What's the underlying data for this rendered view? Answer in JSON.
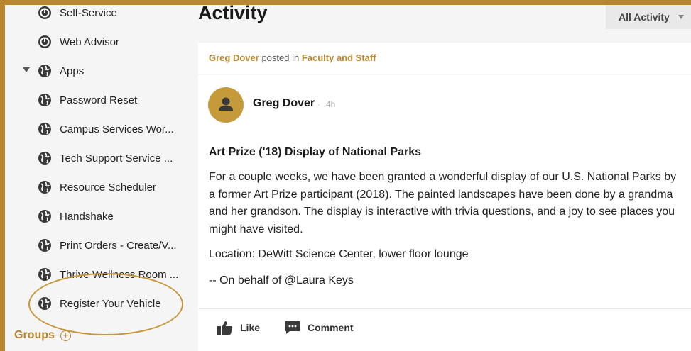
{
  "sidebar": {
    "items": [
      {
        "label": "Self-Service",
        "icon": "web-advisor-icon",
        "caret": false
      },
      {
        "label": "Web Advisor",
        "icon": "web-advisor-icon",
        "caret": false
      },
      {
        "label": "Apps",
        "icon": "globe-icon",
        "caret": true
      },
      {
        "label": "Password Reset",
        "icon": "globe-icon",
        "caret": false
      },
      {
        "label": "Campus Services Wor...",
        "icon": "globe-icon",
        "caret": false
      },
      {
        "label": "Tech Support Service ...",
        "icon": "globe-icon",
        "caret": false
      },
      {
        "label": "Resource Scheduler",
        "icon": "globe-icon",
        "caret": false
      },
      {
        "label": "Handshake",
        "icon": "globe-icon",
        "caret": false
      },
      {
        "label": "Print Orders - Create/V...",
        "icon": "globe-icon",
        "caret": false
      },
      {
        "label": "Thrive Wellness Room ...",
        "icon": "globe-icon",
        "caret": false
      },
      {
        "label": "Register Your Vehicle",
        "icon": "globe-icon",
        "caret": false
      }
    ],
    "groups_label": "Groups",
    "groups_add_symbol": "+"
  },
  "main": {
    "title": "Activity",
    "filter_label": "All Activity"
  },
  "post": {
    "poster": "Greg Dover",
    "posted_in_text": "posted in",
    "group": "Faculty and Staff",
    "author": "Greg Dover",
    "separator": "·",
    "time": "4h",
    "title": "Art Prize ('18) Display of National Parks",
    "body": "For a couple weeks, we have been granted a wonderful display of our U.S. National Parks by a former Art Prize participant (2018). The painted landscapes have been done by a grandma and her grandson. The display is interactive with trivia questions, and a joy to see places you might have visited.",
    "location": "Location: DeWitt Science Center, lower floor lounge",
    "behalf": "-- On behalf of @Laura Keys",
    "like_label": "Like",
    "comment_label": "Comment"
  },
  "colors": {
    "accent": "#b8862f",
    "avatar": "#c49a3a",
    "highlight": "#c9973a"
  }
}
